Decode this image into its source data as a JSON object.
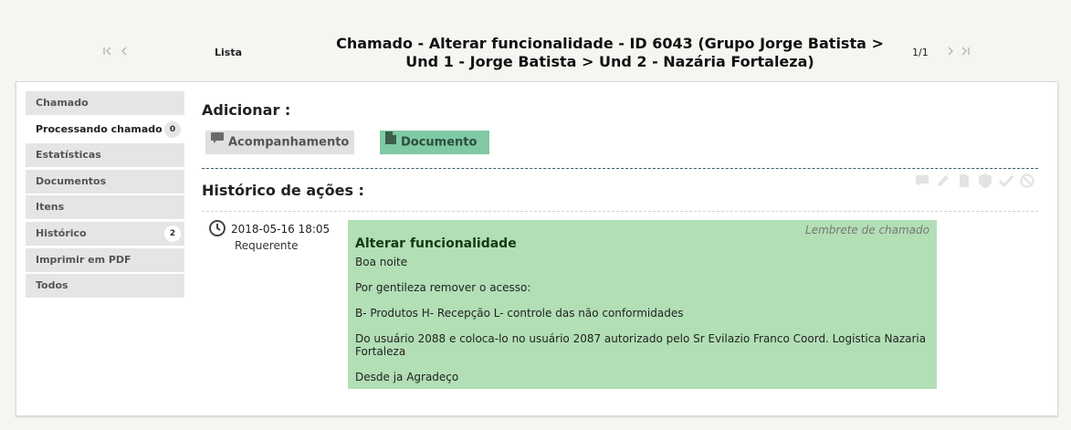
{
  "header": {
    "list_label": "Lista",
    "title_line1": "Chamado - Alterar funcionalidade - ID 6043 (Grupo Jorge Batista >",
    "title_line2": "Und 1 - Jorge Batista > Und 2 - Nazária Fortaleza)",
    "page_counter": "1/1",
    "nav_first_icon": "first-page-icon",
    "nav_prev_icon": "previous-page-icon",
    "nav_next_icon": "next-page-icon",
    "nav_last_icon": "last-page-icon"
  },
  "sidebar": {
    "items": [
      {
        "label": "Chamado",
        "badge": null
      },
      {
        "label": "Processando chamado",
        "badge": "0"
      },
      {
        "label": "Estatísticas",
        "badge": null
      },
      {
        "label": "Documentos",
        "badge": null
      },
      {
        "label": "Itens",
        "badge": null
      },
      {
        "label": "Histórico",
        "badge": "2"
      },
      {
        "label": "Imprimir em PDF",
        "badge": null
      },
      {
        "label": "Todos",
        "badge": null
      }
    ],
    "active_index": 1
  },
  "main": {
    "add_heading": "Adicionar :",
    "buttons": {
      "followup": {
        "label": "Acompanhamento",
        "icon": "comment-icon"
      },
      "document": {
        "label": "Documento",
        "icon": "document-icon",
        "color": "#7fcaa4"
      }
    },
    "history_heading": "Histórico de ações :",
    "filter_icons": [
      "comment-filter-icon",
      "pencil-filter-icon",
      "document-filter-icon",
      "shield-filter-icon",
      "check-filter-icon",
      "ban-filter-icon"
    ],
    "entry": {
      "date": "2018-05-16 18:05",
      "user": "Requerente",
      "type": "Lembrete de chamado",
      "title": "Alterar funcionalidade",
      "lines": [
        "Boa noite",
        "Por gentileza remover o acesso:",
        "B- Produtos H- Recepção L- controle das não conformidades",
        "Do usuário 2088 e coloca-lo no usuário 2087 autorizado pelo Sr Evilazio Franco Coord. Logistica Nazaria Fortaleza",
        "Desde ja Agradeço"
      ],
      "background_color": "#b2dfb5"
    }
  }
}
